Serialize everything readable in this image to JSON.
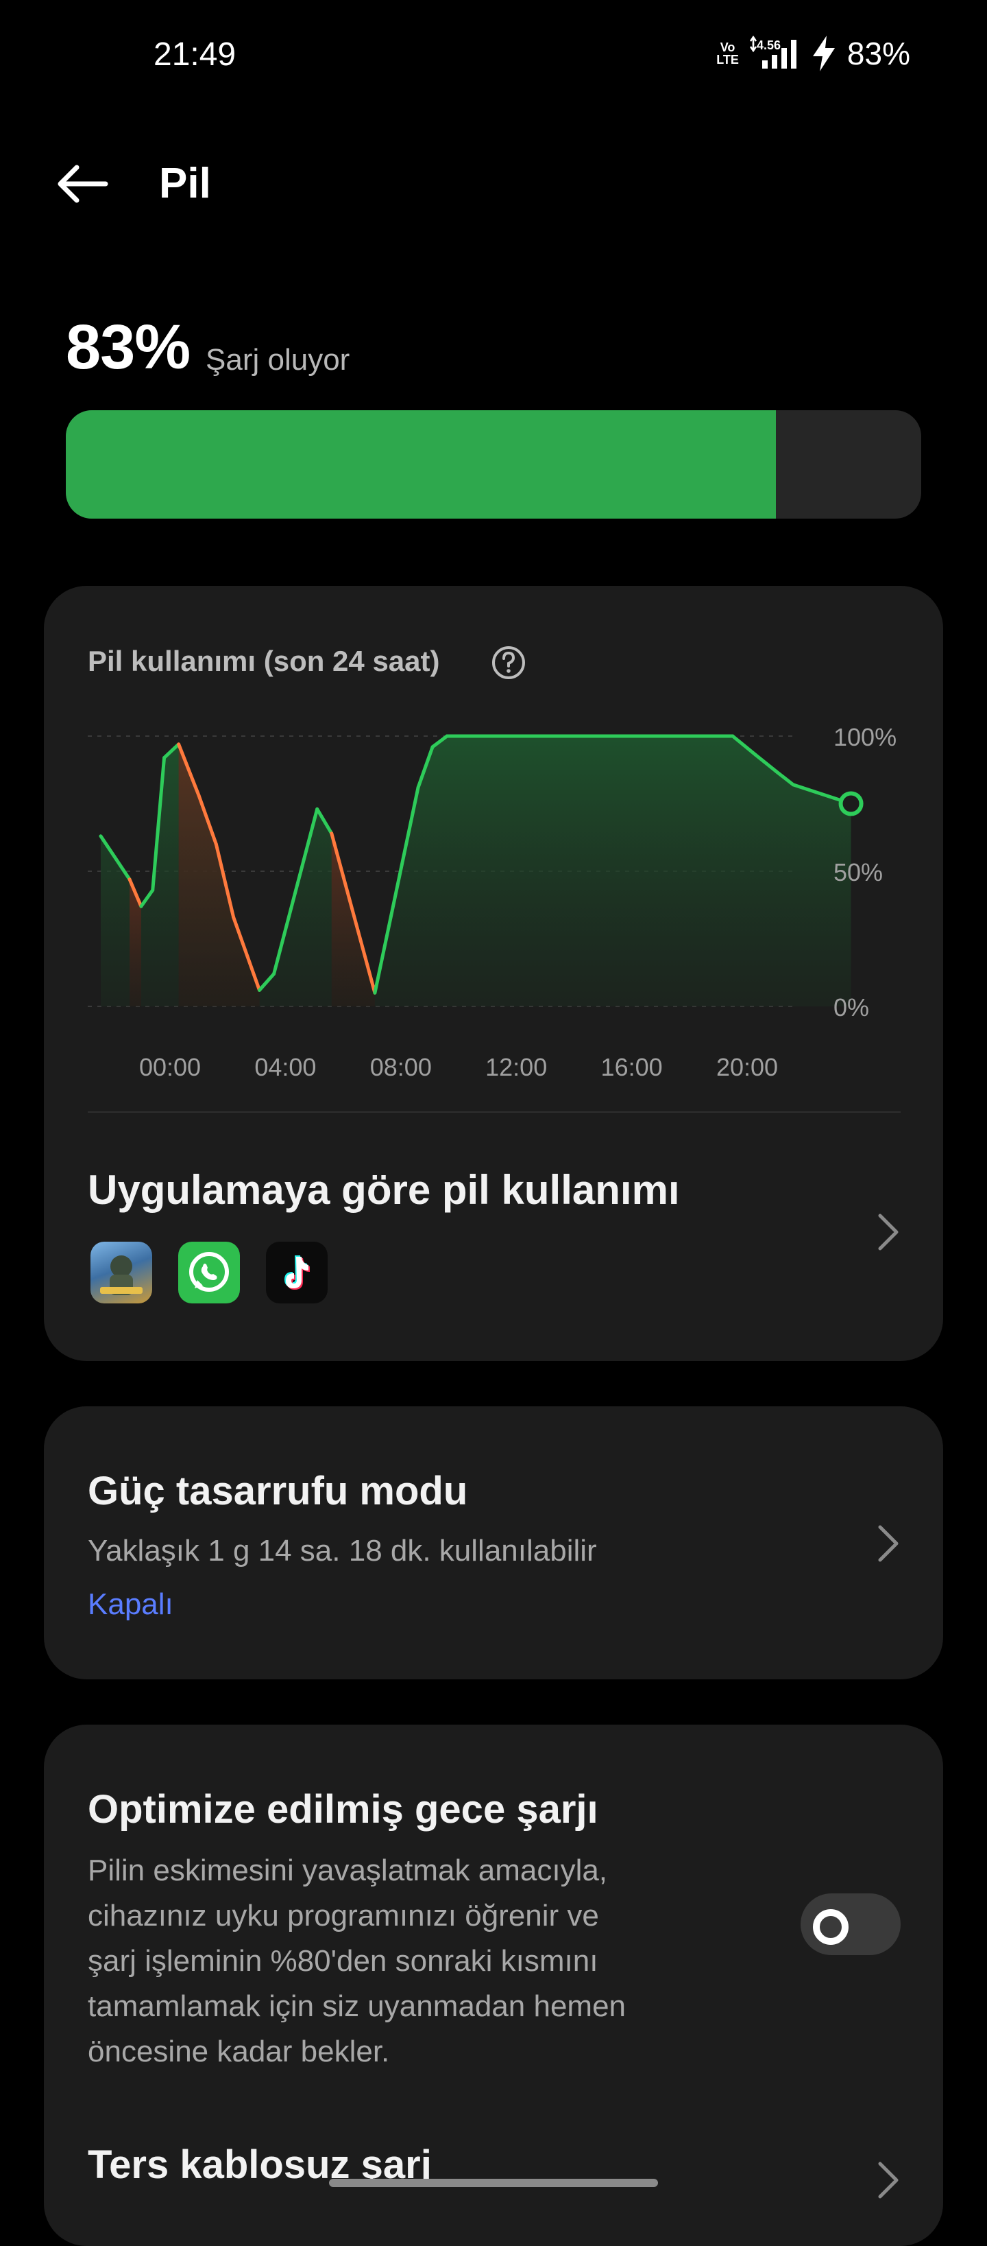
{
  "status_bar": {
    "time": "21:49",
    "network": "4.56",
    "volte": [
      "Vo",
      "LTE"
    ],
    "battery": "83%"
  },
  "header": {
    "title": "Pil"
  },
  "battery": {
    "percent": "83%",
    "state": "Şarj oluyor",
    "level": 0.83,
    "fill_color": "#2ea84d"
  },
  "usage_card": {
    "title": "Pil kullanımı (son 24 saat)",
    "chart_data": {
      "type": "area",
      "y_ticks": [
        "100%",
        "50%",
        "0%"
      ],
      "x_ticks": [
        "00:00",
        "04:00",
        "08:00",
        "12:00",
        "16:00",
        "20:00"
      ],
      "ylim": [
        0,
        100
      ],
      "x_unit": "hours (relative)",
      "grid": true,
      "points": [
        {
          "x": -2.4,
          "y": 63
        },
        {
          "x": -1.4,
          "y": 47
        },
        {
          "x": -1.0,
          "y": 37
        },
        {
          "x": -0.6,
          "y": 43
        },
        {
          "x": -0.2,
          "y": 92
        },
        {
          "x": 0.3,
          "y": 97
        },
        {
          "x": 1.0,
          "y": 78
        },
        {
          "x": 1.6,
          "y": 60
        },
        {
          "x": 2.2,
          "y": 33
        },
        {
          "x": 3.1,
          "y": 6
        },
        {
          "x": 3.6,
          "y": 12
        },
        {
          "x": 5.1,
          "y": 73
        },
        {
          "x": 5.6,
          "y": 64
        },
        {
          "x": 7.1,
          "y": 5
        },
        {
          "x": 8.6,
          "y": 81
        },
        {
          "x": 9.1,
          "y": 96
        },
        {
          "x": 9.6,
          "y": 100
        },
        {
          "x": 19.5,
          "y": 100
        },
        {
          "x": 20.3,
          "y": 93
        },
        {
          "x": 21.0,
          "y": 87
        },
        {
          "x": 21.6,
          "y": 82
        },
        {
          "x": 23.6,
          "y": 75
        }
      ],
      "discharge_segments": [
        [
          1,
          2
        ],
        [
          5,
          9
        ],
        [
          12,
          13
        ]
      ],
      "colors": {
        "charge": "#2ecc5a",
        "discharge": "#ff7a3d",
        "grid": "#3a3a3a",
        "tick": "#a0a0a0"
      }
    },
    "by_app": {
      "title": "Uygulamaya göre pil kullanımı",
      "apps": [
        "pubg-icon",
        "whatsapp-icon",
        "tiktok-icon"
      ]
    }
  },
  "power_saving": {
    "title": "Güç tasarrufu modu",
    "subtitle": "Yaklaşık 1 g 14 sa. 18 dk. kullanılabilir",
    "status": "Kapalı"
  },
  "optimized_charging": {
    "title": "Optimize edilmiş gece şarjı",
    "description": [
      "Pilin eskimesini yavaşlatmak amacıyla,",
      "cihazınız uyku programınızı öğrenir ve",
      "şarj işleminin %80'den sonraki kısmını",
      "tamamlamak için siz uyanmadan hemen",
      "öncesine kadar bekler."
    ],
    "toggle_on": false
  },
  "reverse_wireless": {
    "title": "Ters kablosuz şarj"
  }
}
